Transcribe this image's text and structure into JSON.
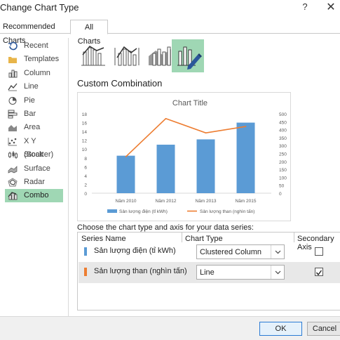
{
  "window": {
    "title": "Change Chart Type",
    "help_label": "?",
    "close_label": "✕"
  },
  "tabs": [
    {
      "label": "Recommended Charts",
      "selected": false
    },
    {
      "label": "All Charts",
      "selected": true
    }
  ],
  "sidebar": {
    "items": [
      {
        "label": "Recent",
        "icon": "recent-icon",
        "selected": false
      },
      {
        "label": "Templates",
        "icon": "folder-icon",
        "selected": false
      },
      {
        "label": "Column",
        "icon": "column-chart-icon",
        "selected": false
      },
      {
        "label": "Line",
        "icon": "line-chart-icon",
        "selected": false
      },
      {
        "label": "Pie",
        "icon": "pie-chart-icon",
        "selected": false
      },
      {
        "label": "Bar",
        "icon": "bar-chart-icon",
        "selected": false
      },
      {
        "label": "Area",
        "icon": "area-chart-icon",
        "selected": false
      },
      {
        "label": "X Y (Scatter)",
        "icon": "scatter-chart-icon",
        "selected": false
      },
      {
        "label": "Stock",
        "icon": "stock-chart-icon",
        "selected": false
      },
      {
        "label": "Surface",
        "icon": "surface-chart-icon",
        "selected": false
      },
      {
        "label": "Radar",
        "icon": "radar-chart-icon",
        "selected": false
      },
      {
        "label": "Combo",
        "icon": "combo-chart-icon",
        "selected": true
      }
    ]
  },
  "subtypes": [
    {
      "icon": "clustered-column-line-icon",
      "selected": false
    },
    {
      "icon": "clustered-column-line-secondary-axis-icon",
      "selected": false
    },
    {
      "icon": "stacked-area-clustered-column-icon",
      "selected": false
    },
    {
      "icon": "custom-combination-icon",
      "selected": true
    }
  ],
  "main": {
    "heading": "Custom Combination",
    "choose_label": "Choose the chart type and axis for your data series:"
  },
  "series_table": {
    "headers": {
      "name": "Series Name",
      "type": "Chart Type",
      "axis": "Secondary Axis"
    },
    "rows": [
      {
        "name": "Sản lượng điện (tỉ kWh)",
        "color": "#5b9bd5",
        "chart_type": "Clustered Column",
        "secondary_axis": false
      },
      {
        "name": "Sản lượng than (nghìn tấn)",
        "color": "#ed7d31",
        "chart_type": "Line",
        "secondary_axis": true
      }
    ]
  },
  "footer": {
    "ok_label": "OK",
    "cancel_label": "Cancel"
  },
  "colors": {
    "accent_green": "#9fd7b4",
    "series_blue": "#5b9bd5",
    "series_orange": "#ed7d31"
  },
  "chart_data": {
    "type": "bar",
    "title": "Chart Title",
    "categories": [
      "Năm 2010",
      "Năm 2012",
      "Năm 2013",
      "Năm 2015"
    ],
    "series": [
      {
        "name": "Sản lượng điện (tỉ kWh)",
        "type": "bar",
        "axis": "primary",
        "values": [
          8.5,
          11,
          12.2,
          16
        ]
      },
      {
        "name": "Sản lượng than (nghìn tấn)",
        "type": "line",
        "axis": "secondary",
        "values": [
          230,
          470,
          380,
          420
        ]
      }
    ],
    "primary_axis": {
      "min": 0,
      "max": 18,
      "ticks": [
        0,
        2,
        4,
        6,
        8,
        10,
        12,
        14,
        16,
        18
      ]
    },
    "secondary_axis": {
      "min": 0,
      "max": 500,
      "ticks": [
        0,
        50,
        100,
        150,
        200,
        250,
        300,
        350,
        400,
        450,
        500
      ]
    },
    "legend": "bottom",
    "grid": false
  }
}
